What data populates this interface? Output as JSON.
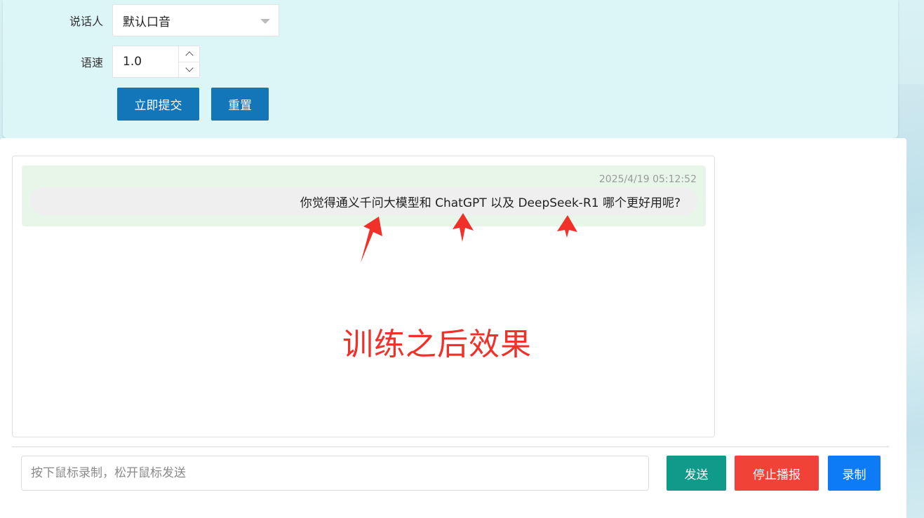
{
  "settings": {
    "speaker_label": "说话人",
    "speaker_value": "默认口音",
    "speed_label": "语速",
    "speed_value": "1.0",
    "submit_label": "立即提交",
    "reset_label": "重置"
  },
  "chat": {
    "messages": [
      {
        "time": "2025/4/19 05:12:52",
        "text": "你觉得通义千问大模型和 ChatGPT 以及 DeepSeek-R1 哪个更好用呢?"
      }
    ],
    "annotation": "训练之后效果"
  },
  "composer": {
    "placeholder": "按下鼠标录制，松开鼠标发送",
    "send_label": "发送",
    "stop_label": "停止播报",
    "record_label": "录制"
  },
  "colors": {
    "primary": "#1276b8",
    "send": "#0f9a8a",
    "stop": "#f04236",
    "record": "#0d7bf5",
    "annotation": "#f2302a"
  }
}
